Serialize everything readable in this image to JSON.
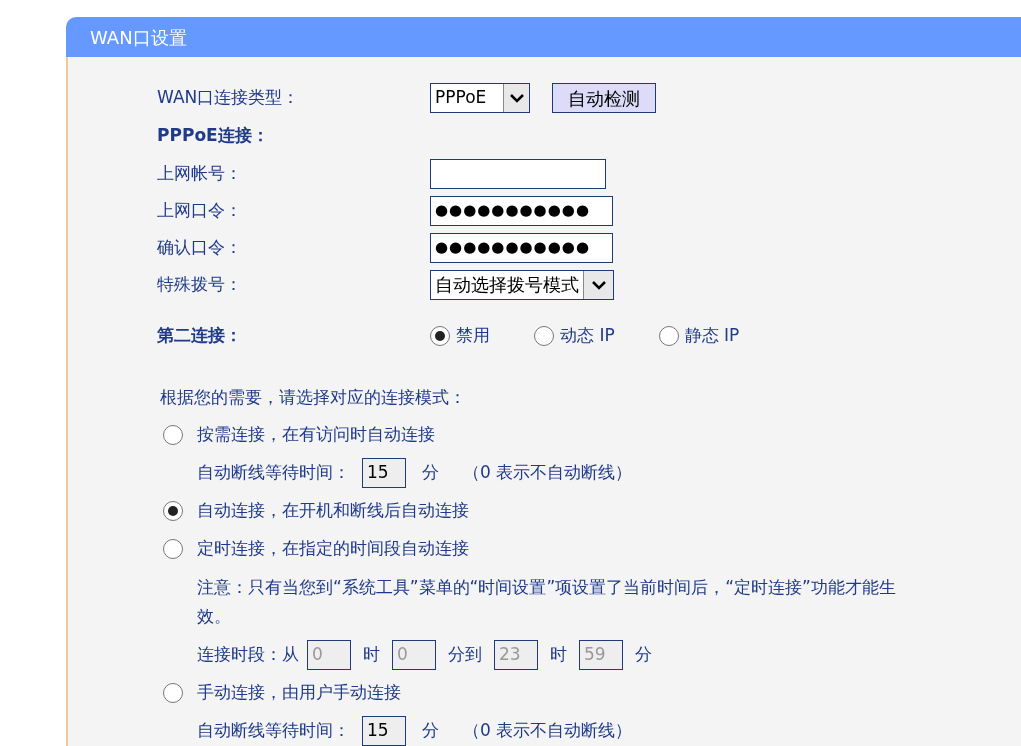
{
  "panel_title": "WAN口设置",
  "wan_type": {
    "label": "WAN口连接类型：",
    "value": "PPPoE",
    "button": "自动检测"
  },
  "pppoe_heading": "PPPoE连接：",
  "fields": [
    {
      "kind": "text",
      "label": "上网帐号："
    },
    {
      "kind": "password",
      "label": "上网口令：",
      "value": "●●●●●●●●●●●"
    },
    {
      "kind": "password",
      "label": "确认口令：",
      "value": "●●●●●●●●●●●"
    },
    {
      "kind": "select",
      "label": "特殊拨号：",
      "value": "自动选择拨号模式"
    }
  ],
  "second_connection": {
    "label": "第二连接：",
    "options": [
      {
        "label": "禁用",
        "selected": true
      },
      {
        "label": "动态 IP",
        "selected": false
      },
      {
        "label": "静态 IP",
        "selected": false
      }
    ]
  },
  "mode_intro": "根据您的需要，请选择对应的连接模式：",
  "modes": [
    {
      "label": "按需连接，在有访问时自动连接",
      "selected": false,
      "details": [
        {
          "kind": "timeout",
          "label": "自动断线等待时间：",
          "value": "15",
          "unit": "分",
          "hint": "（0 表示不自动断线）"
        }
      ]
    },
    {
      "label": "自动连接，在开机和断线后自动连接",
      "selected": true
    },
    {
      "label": "定时连接，在指定的时间段自动连接",
      "selected": false,
      "details": [
        {
          "kind": "note",
          "text": "注意：只有当您到“系统工具”菜单的“时间设置”项设置了当前时间后，“定时连接”功能才能生效。"
        },
        {
          "kind": "period",
          "label": "连接时段：从",
          "disabled": true,
          "parts": [
            {
              "value": "0",
              "unit": "时"
            },
            {
              "value": "0",
              "unit": "分到"
            },
            {
              "value": "23",
              "unit": "时"
            },
            {
              "value": "59",
              "unit": "分"
            }
          ]
        }
      ]
    },
    {
      "label": "手动连接，由用户手动连接",
      "selected": false,
      "details": [
        {
          "kind": "timeout",
          "label": "自动断线等待时间：",
          "value": "15",
          "unit": "分",
          "hint": "（0 表示不自动断线）"
        }
      ]
    }
  ]
}
